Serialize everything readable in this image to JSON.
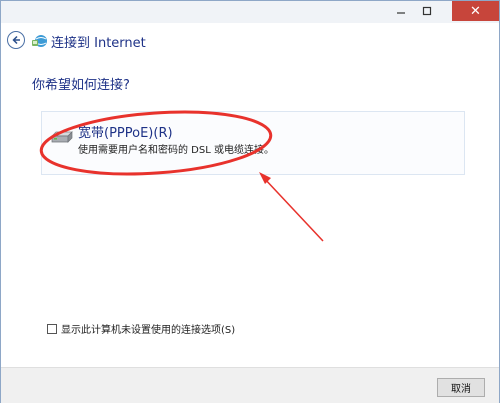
{
  "window": {
    "title": "连接到 Internet",
    "controls": {
      "minimize_icon": "minimize-icon",
      "maximize_icon": "maximize-icon",
      "close_glyph": "✕"
    }
  },
  "main": {
    "question": "你希望如何连接?",
    "options": [
      {
        "title": "宽带(PPPoE)(R)",
        "description": "使用需要用户名和密码的 DSL 或电缆连接。",
        "icon": "modem-icon"
      }
    ]
  },
  "checkbox": {
    "label": "显示此计算机未设置使用的连接选项(S)",
    "checked": false
  },
  "footer": {
    "cancel_label": "取消"
  },
  "colors": {
    "title_blue": "#1e3287",
    "annotation_red": "#e8322c",
    "close_red": "#c7453b"
  }
}
